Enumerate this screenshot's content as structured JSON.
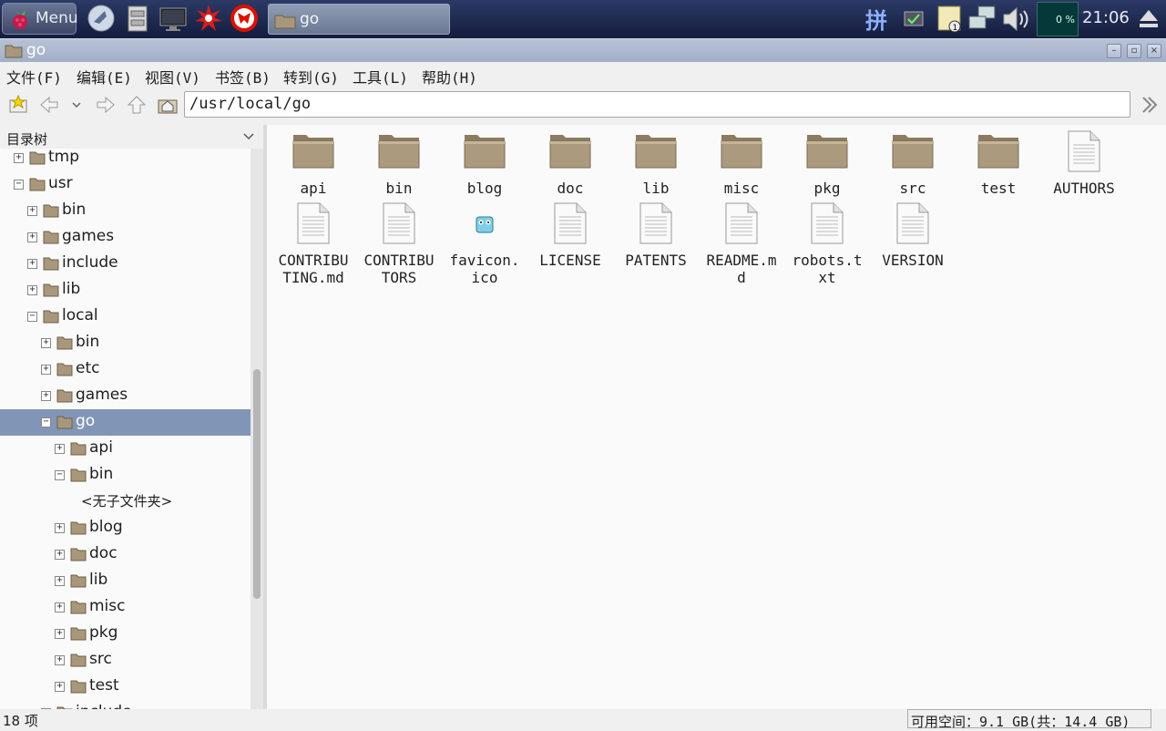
{
  "taskbar": {
    "menu_label": "Menu",
    "task_title": "go",
    "ime_label": "拼",
    "cpu_label": "0 %",
    "clock": "21:06"
  },
  "window": {
    "title": "go"
  },
  "menubar": [
    "文件(F)",
    "编辑(E)",
    "视图(V)",
    "书签(B)",
    "转到(G)",
    "工具(L)",
    "帮助(H)"
  ],
  "address": {
    "path": "/usr/local/go"
  },
  "sidebar": {
    "header": "目录树",
    "nodes": [
      {
        "label": "tmp",
        "expander": "+"
      },
      {
        "label": "usr",
        "expander": "−"
      },
      {
        "label": "bin",
        "expander": "+"
      },
      {
        "label": "games",
        "expander": "+"
      },
      {
        "label": "include",
        "expander": "+"
      },
      {
        "label": "lib",
        "expander": "+"
      },
      {
        "label": "local",
        "expander": "−"
      },
      {
        "label": "bin",
        "expander": "+"
      },
      {
        "label": "etc",
        "expander": "+"
      },
      {
        "label": "games",
        "expander": "+"
      },
      {
        "label": "go",
        "expander": "−"
      },
      {
        "label": "api",
        "expander": "+"
      },
      {
        "label": "bin",
        "expander": "−"
      },
      {
        "label": "<无子文件夹>"
      },
      {
        "label": "blog",
        "expander": "+"
      },
      {
        "label": "doc",
        "expander": "+"
      },
      {
        "label": "lib",
        "expander": "+"
      },
      {
        "label": "misc",
        "expander": "+"
      },
      {
        "label": "pkg",
        "expander": "+"
      },
      {
        "label": "src",
        "expander": "+"
      },
      {
        "label": "test",
        "expander": "+"
      },
      {
        "label": "include",
        "expander": "+"
      }
    ]
  },
  "files": [
    {
      "name": "api",
      "type": "folder"
    },
    {
      "name": "bin",
      "type": "folder"
    },
    {
      "name": "blog",
      "type": "folder"
    },
    {
      "name": "doc",
      "type": "folder"
    },
    {
      "name": "lib",
      "type": "folder"
    },
    {
      "name": "misc",
      "type": "folder"
    },
    {
      "name": "pkg",
      "type": "folder"
    },
    {
      "name": "src",
      "type": "folder"
    },
    {
      "name": "test",
      "type": "folder"
    },
    {
      "name": "AUTHORS",
      "type": "file"
    },
    {
      "name": "CONTRIBUTING.md",
      "type": "file"
    },
    {
      "name": "CONTRIBUTORS",
      "type": "file"
    },
    {
      "name": "favicon.ico",
      "type": "image"
    },
    {
      "name": "LICENSE",
      "type": "file"
    },
    {
      "name": "PATENTS",
      "type": "file"
    },
    {
      "name": "README.md",
      "type": "file"
    },
    {
      "name": "robots.txt",
      "type": "file"
    },
    {
      "name": "VERSION",
      "type": "file"
    }
  ],
  "statusbar": {
    "count": "18 项",
    "free": "可用空间：9.1 GB(共：14.4 GB)"
  },
  "colors": {
    "selection": "#8196b6",
    "folder": "#a8977a",
    "taskbar": "#1c2648"
  }
}
